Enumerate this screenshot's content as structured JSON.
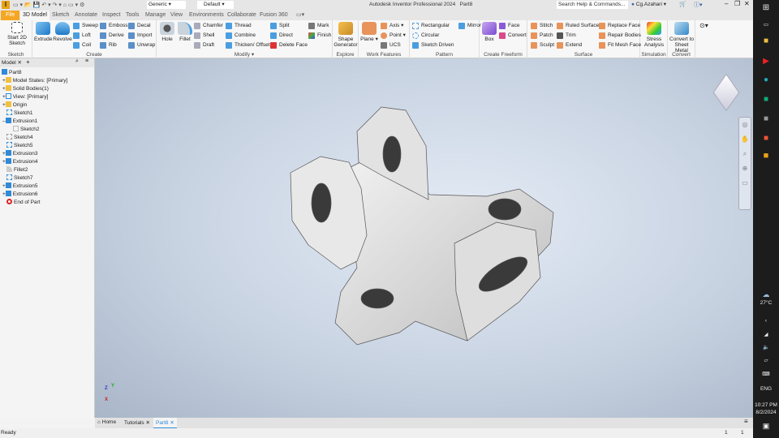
{
  "title": {
    "app": "Autodesk Inventor Professional 2024",
    "doc": "Part8",
    "search_placeholder": "Search Help & Commands...",
    "user": "Cg.Azahari",
    "material": "Generic",
    "appearance": "Default"
  },
  "tabs": [
    "File",
    "3D Model",
    "Sketch",
    "Annotate",
    "Inspect",
    "Tools",
    "Manage",
    "View",
    "Environments",
    "Collaborate",
    "Fusion 360"
  ],
  "ribbon": {
    "groups": [
      "Sketch",
      "Create",
      "Modify",
      "Explore",
      "Work Features",
      "Pattern",
      "Create Freeform",
      "Surface",
      "Simulation",
      "Convert"
    ],
    "sketch": {
      "start": "Start 2D Sketch"
    },
    "create": {
      "extrude": "Extrude",
      "revolve": "Revolve",
      "sweep": "Sweep",
      "loft": "Loft",
      "coil": "Coil",
      "emboss": "Emboss",
      "derive": "Derive",
      "rib": "Rib",
      "decal": "Decal",
      "import": "Import",
      "unwrap": "Unwrap"
    },
    "modify": {
      "hole": "Hole",
      "fillet": "Fillet",
      "chamfer": "Chamfer",
      "shell": "Shell",
      "draft": "Draft",
      "thread": "Thread",
      "combine": "Combine",
      "thicken": "Thicken/ Offset",
      "split": "Split",
      "direct": "Direct",
      "delete_face": "Delete Face",
      "mark": "Mark",
      "finish": "Finish"
    },
    "explore": {
      "shape_generator": "Shape Generator"
    },
    "work": {
      "plane": "Plane",
      "axis": "Axis",
      "point": "Point",
      "ucs": "UCS"
    },
    "pattern": {
      "rectangular": "Rectangular",
      "circular": "Circular",
      "sketch_driven": "Sketch Driven",
      "mirror": "Mirror"
    },
    "freeform": {
      "box": "Box",
      "face": "Face",
      "convert": "Convert"
    },
    "surface": {
      "stitch": "Stitch",
      "patch": "Patch",
      "sculpt": "Sculpt",
      "ruled": "Ruled Surface",
      "trim": "Trim",
      "extend": "Extend",
      "replace": "Replace Face",
      "repair": "Repair Bodies",
      "fitmesh": "Fit Mesh Face"
    },
    "simulation": {
      "stress": "Stress Analysis"
    },
    "convert": {
      "sheet_metal": "Convert to Sheet Metal"
    }
  },
  "browser": {
    "tab": "Model",
    "items": [
      "Part8",
      "Model States: [Primary]",
      "Solid Bodies(1)",
      "View: [Primary]",
      "Origin",
      "Sketch1",
      "Extrusion1",
      "Sketch2",
      "Sketch4",
      "Sketch5",
      "Extrusion3",
      "Extrusion4",
      "Fillet2",
      "Sketch7",
      "Extrusion5",
      "Extrusion6",
      "End of Part"
    ]
  },
  "doc_tabs": [
    "Home",
    "Tutorials",
    "Part8"
  ],
  "status": {
    "text": "Ready",
    "page1": "1",
    "page2": "1"
  },
  "axes": {
    "x": "X",
    "y": "Y",
    "z": "Z"
  },
  "taskbar": {
    "temp": "27°C",
    "lang": "ENG",
    "time": "10:27 PM",
    "date": "8/2/2024"
  },
  "colors": {
    "accent": "#f5a623",
    "viewport": "#c8d3e2",
    "part": "#d9d9d9"
  }
}
